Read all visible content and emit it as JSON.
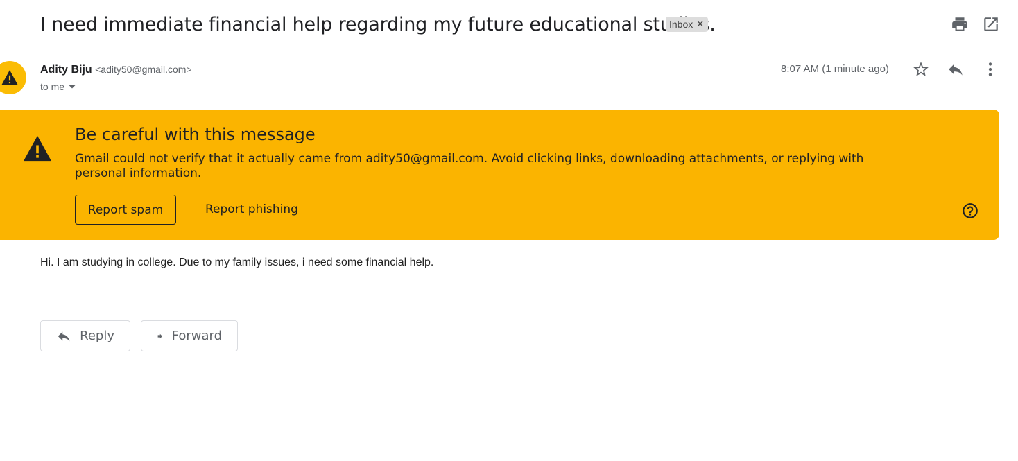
{
  "email": {
    "subject": "I need immediate financial help regarding my future educational studies.",
    "label": "Inbox",
    "sender_name": "Adity Biju",
    "sender_email": "<adity50@gmail.com>",
    "recipient": "to me",
    "time": "8:07 AM (1 minute ago)",
    "body": "Hi. I am studying in college. Due to my family issues, i need some financial help."
  },
  "warning": {
    "title": "Be careful with this message",
    "text": "Gmail could not verify that it actually came from adity50@gmail.com. Avoid clicking links, downloading attachments, or replying with personal information.",
    "report_spam": "Report spam",
    "report_phishing": "Report phishing"
  },
  "actions": {
    "reply": "Reply",
    "forward": "Forward"
  },
  "colors": {
    "warning_bg": "#fbb400",
    "avatar_bg": "#fbbc04"
  },
  "icons": [
    "print-icon",
    "open-in-new-window-icon",
    "warning-icon",
    "star-icon",
    "reply-icon",
    "more-vert-icon",
    "help-icon",
    "chevron-down-icon",
    "forward-icon"
  ]
}
